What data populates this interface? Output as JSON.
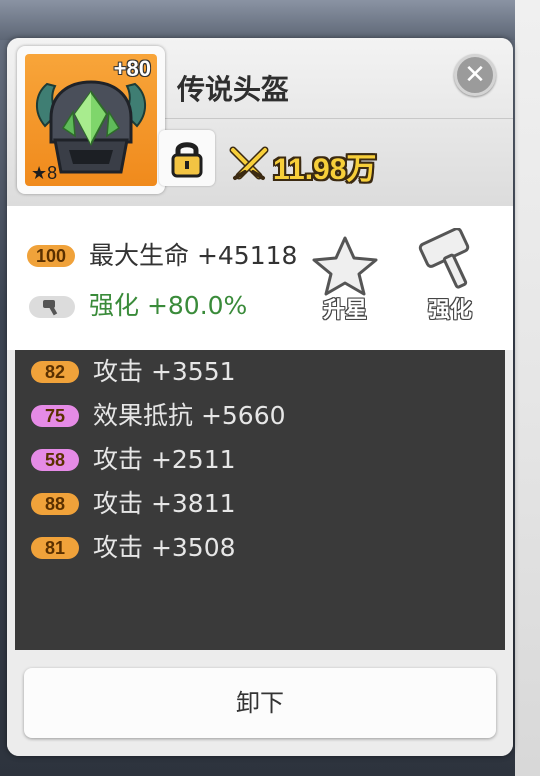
{
  "item": {
    "name": "传说头盔",
    "enhance_level": "+80",
    "stars": "★8",
    "icon": "helmet-icon",
    "frame_color": "#f39a2a"
  },
  "power": {
    "icon": "crossed-swords-icon",
    "value": "11.98万"
  },
  "main_stats": [
    {
      "badge": "100",
      "label": "最大生命 +45118",
      "badge_color": "#f0a23a"
    },
    {
      "badge_icon": "hammer-icon",
      "label": "强化 +80.0%",
      "text_color": "#3a8b3a"
    }
  ],
  "actions": {
    "star_up_label": "升星",
    "enhance_label": "强化"
  },
  "sub_stats": [
    {
      "badge": "82",
      "label": "攻击 +3551",
      "badge_color": "#f0a23a"
    },
    {
      "badge": "75",
      "label": "效果抵抗 +5660",
      "badge_color": "#e58be6"
    },
    {
      "badge": "58",
      "label": "攻击 +2511",
      "badge_color": "#e58be6"
    },
    {
      "badge": "88",
      "label": "攻击 +3811",
      "badge_color": "#f0a23a"
    },
    {
      "badge": "81",
      "label": "攻击 +3508",
      "badge_color": "#f0a23a"
    }
  ],
  "footer": {
    "unequip_label": "卸下"
  }
}
